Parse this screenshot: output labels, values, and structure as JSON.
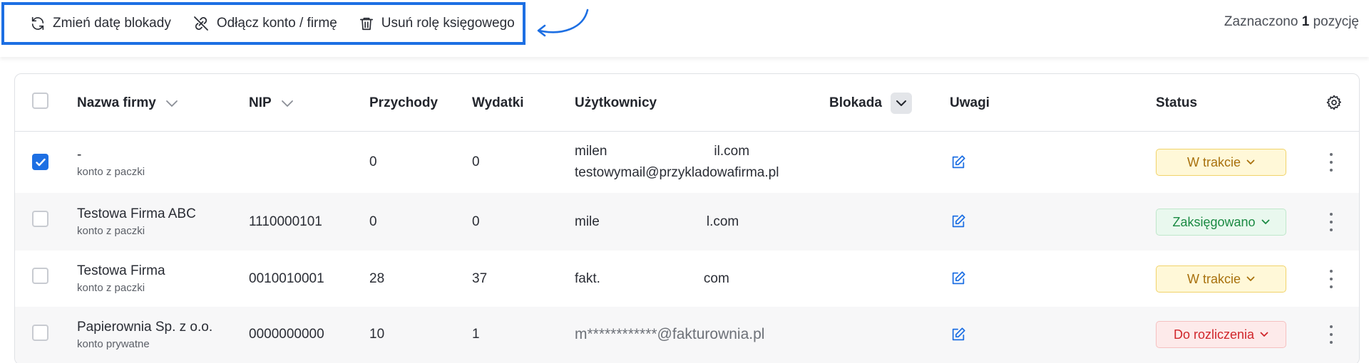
{
  "toolbar": {
    "actions": [
      {
        "label": "Zmień datę blokady",
        "icon": "refresh-icon"
      },
      {
        "label": "Odłącz konto / firmę",
        "icon": "unlink-icon"
      },
      {
        "label": "Usuń rolę księgowego",
        "icon": "trash-icon"
      }
    ],
    "selected_prefix": "Zaznaczono ",
    "selected_count": "1",
    "selected_suffix": " pozycję",
    "highlight_color": "#1d6fe3"
  },
  "table": {
    "headers": {
      "name": "Nazwa firmy",
      "nip": "NIP",
      "income": "Przychody",
      "expenses": "Wydatki",
      "users": "Użytkownicy",
      "lock": "Blokada",
      "notes": "Uwagi",
      "status": "Status"
    },
    "rows": [
      {
        "checked": true,
        "name": "-",
        "sub": "konto z paczki",
        "nip": "",
        "income": "0",
        "expenses": "0",
        "users": [
          {
            "start": "milen",
            "end": "il.com"
          },
          {
            "full": "testowymail@przykladowafirma.pl"
          }
        ],
        "status": "W trakcie",
        "status_color": "yellow"
      },
      {
        "checked": false,
        "name": "Testowa Firma ABC",
        "sub": "konto z paczki",
        "nip": "1110000101",
        "income": "0",
        "expenses": "0",
        "users": [
          {
            "start": "mile",
            "end": "l.com"
          }
        ],
        "status": "Zaksięgowano",
        "status_color": "green"
      },
      {
        "checked": false,
        "name": "Testowa Firma",
        "sub": "konto z paczki",
        "nip": "0010010001",
        "income": "28",
        "expenses": "37",
        "users": [
          {
            "start": "fakt.",
            "end": "com"
          }
        ],
        "status": "W trakcie",
        "status_color": "yellow"
      },
      {
        "checked": false,
        "name": "Papierownia Sp. z o.o.",
        "sub": "konto prywatne",
        "nip": "0000000000",
        "income": "10",
        "expenses": "1",
        "users": [
          {
            "full": "m************@fakturownia.pl"
          }
        ],
        "status": "Do rozliczenia",
        "status_color": "red"
      }
    ]
  }
}
